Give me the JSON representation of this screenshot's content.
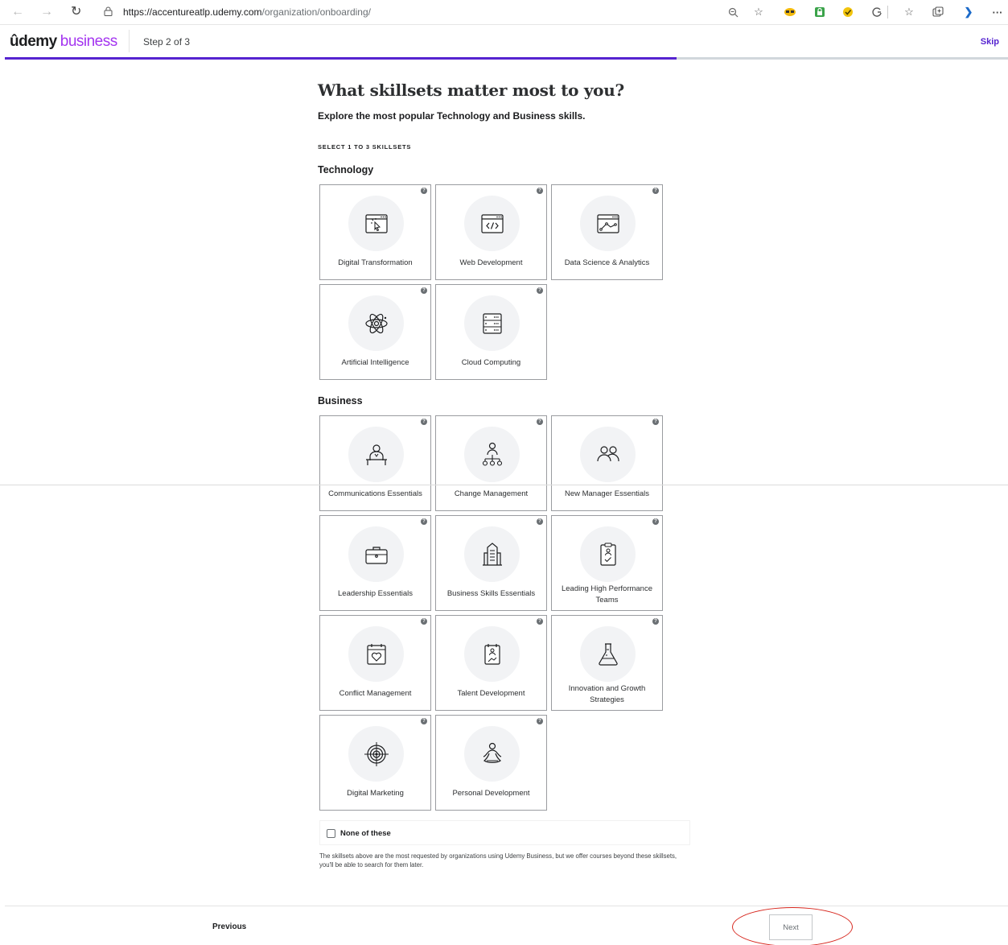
{
  "browser": {
    "url_host": "https://accentureatlp.udemy.com",
    "url_path": "/organization/onboarding/",
    "back_icon": "arrow-left",
    "forward_icon": "arrow-right",
    "reload_icon": "reload",
    "more_icon": "···"
  },
  "header": {
    "logo_main": "ûdemy",
    "logo_suffix": "business",
    "step": "Step 2 of 3",
    "skip": "Skip",
    "progress_fraction": 0.67
  },
  "main": {
    "title": "What skillsets matter most to you?",
    "subtitle": "Explore the most popular Technology and Business skills.",
    "select_note": "SELECT 1 TO 3 SKILLSETS"
  },
  "technology": {
    "heading": "Technology",
    "cards": [
      {
        "label": "Digital Transformation",
        "icon": "browser-cursor-icon"
      },
      {
        "label": "Web Development",
        "icon": "browser-code-icon"
      },
      {
        "label": "Data Science & Analytics",
        "icon": "browser-chart-icon"
      },
      {
        "label": "Artificial Intelligence",
        "icon": "atom-icon"
      },
      {
        "label": "Cloud Computing",
        "icon": "server-icon"
      }
    ]
  },
  "business": {
    "heading": "Business",
    "cards": [
      {
        "label": "Communications Essentials",
        "icon": "speaker-podium-icon"
      },
      {
        "label": "Change Management",
        "icon": "org-chart-person-icon"
      },
      {
        "label": "New Manager Essentials",
        "icon": "two-people-icon"
      },
      {
        "label": "Leadership Essentials",
        "icon": "briefcase-icon"
      },
      {
        "label": "Business Skills Essentials",
        "icon": "office-building-icon"
      },
      {
        "label": "Leading High Performance Teams",
        "icon": "clipboard-person-check-icon"
      },
      {
        "label": "Conflict Management",
        "icon": "calendar-heart-icon"
      },
      {
        "label": "Talent Development",
        "icon": "clipboard-person-growth-icon"
      },
      {
        "label": "Innovation and Growth Strategies",
        "icon": "flask-icon"
      },
      {
        "label": "Digital Marketing",
        "icon": "target-icon"
      },
      {
        "label": "Personal Development",
        "icon": "meditation-icon"
      }
    ]
  },
  "none_of_these": {
    "label": "None of these",
    "checked": false
  },
  "footnote": "The skillsets above are the most requested by organizations using Udemy Business, but we offer courses beyond these skillsets, you'll be able to search for them later.",
  "footer": {
    "previous": "Previous",
    "next": "Next"
  },
  "colors": {
    "brand_purple": "#a435f0",
    "progress_purple": "#5624d0",
    "annotation_red": "#d7281f"
  }
}
